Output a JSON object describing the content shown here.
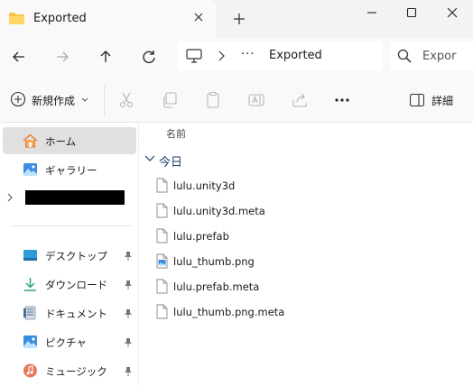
{
  "window": {
    "tab_title": "Exported"
  },
  "address_bar": {
    "ellipsis": "···",
    "current_folder": "Exported"
  },
  "search": {
    "placeholder": "Expor"
  },
  "toolbar": {
    "new_label": "新規作成",
    "details_label": "詳細",
    "more_label": "···"
  },
  "sidebar": {
    "items": [
      {
        "label": "ホーム",
        "icon": "home-icon"
      },
      {
        "label": "ギャラリー",
        "icon": "gallery-icon"
      },
      {
        "label": "デスクトップ",
        "icon": "desktop-icon"
      },
      {
        "label": "ダウンロード",
        "icon": "download-icon"
      },
      {
        "label": "ドキュメント",
        "icon": "document-icon"
      },
      {
        "label": "ピクチャ",
        "icon": "pictures-icon"
      },
      {
        "label": "ミュージック",
        "icon": "music-icon"
      }
    ]
  },
  "content": {
    "column_name": "名前",
    "group_label": "今日",
    "files": [
      {
        "name": "lulu.unity3d",
        "icon": "file-icon"
      },
      {
        "name": "lulu.unity3d.meta",
        "icon": "file-icon"
      },
      {
        "name": "lulu.prefab",
        "icon": "file-icon"
      },
      {
        "name": "lulu_thumb.png",
        "icon": "image-file-icon"
      },
      {
        "name": "lulu.prefab.meta",
        "icon": "file-icon"
      },
      {
        "name": "lulu_thumb.png.meta",
        "icon": "file-icon"
      }
    ]
  },
  "colors": {
    "accent": "#0067c0",
    "folder": "#f5c242",
    "selection": "#e0e0e0"
  }
}
